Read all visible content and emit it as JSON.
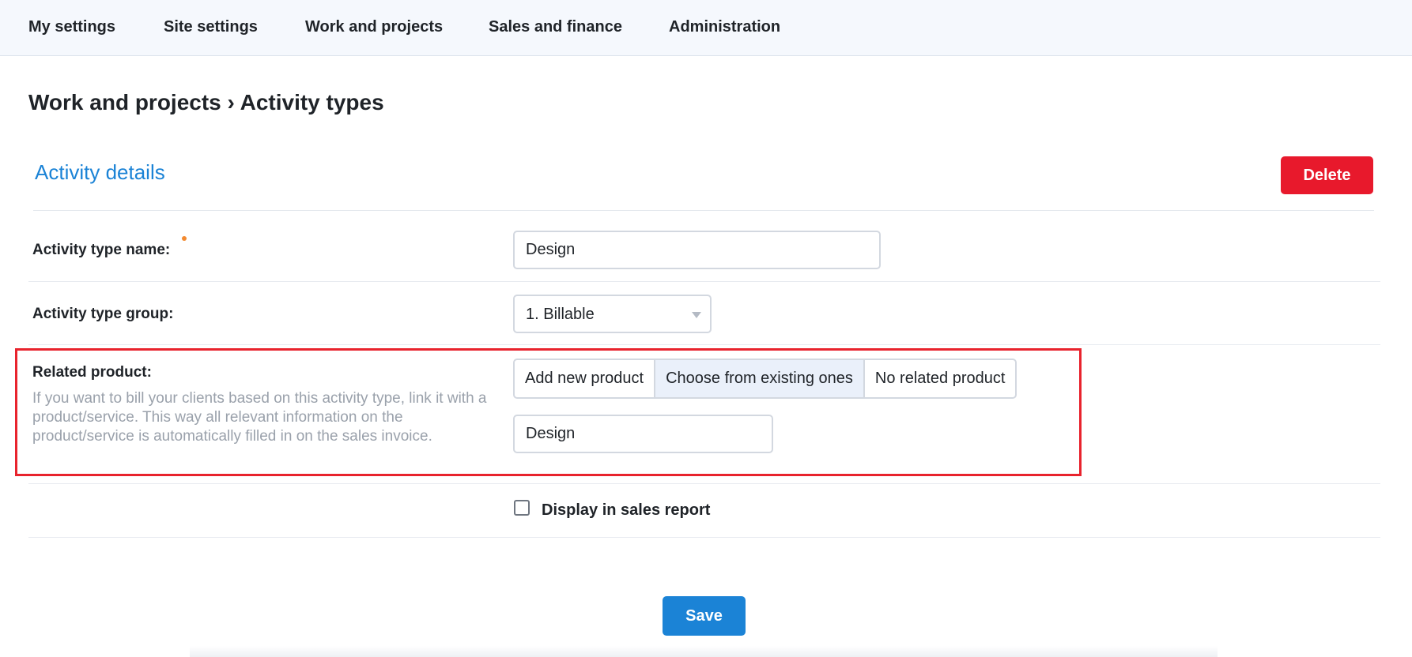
{
  "nav": {
    "items": [
      {
        "label": "My settings"
      },
      {
        "label": "Site settings"
      },
      {
        "label": "Work and projects"
      },
      {
        "label": "Sales and finance"
      },
      {
        "label": "Administration"
      }
    ]
  },
  "page": {
    "breadcrumb": "Work and projects › Activity types"
  },
  "section": {
    "title": "Activity details",
    "delete_label": "Delete"
  },
  "form": {
    "activity_type_name": {
      "label": "Activity type name:",
      "value": "Design"
    },
    "activity_type_group": {
      "label": "Activity type group:",
      "selected": "1. Billable"
    },
    "related_product": {
      "label": "Related product:",
      "help": "If you want to bill your clients based on this activity type, link it with a product/service. This way all relevant information on the product/service is automatically filled in on the sales invoice.",
      "options": [
        {
          "label": "Add new product"
        },
        {
          "label": "Choose from existing ones"
        },
        {
          "label": "No related product"
        }
      ],
      "selected_option": "Choose from existing ones",
      "value": "Design"
    },
    "display_in_sales_report": {
      "label": "Display in sales report",
      "checked": false
    },
    "save_label": "Save"
  },
  "colors": {
    "accent": "#1b83d6",
    "danger": "#e8192c",
    "highlight": "#e8232d",
    "required": "#f38a2f"
  }
}
